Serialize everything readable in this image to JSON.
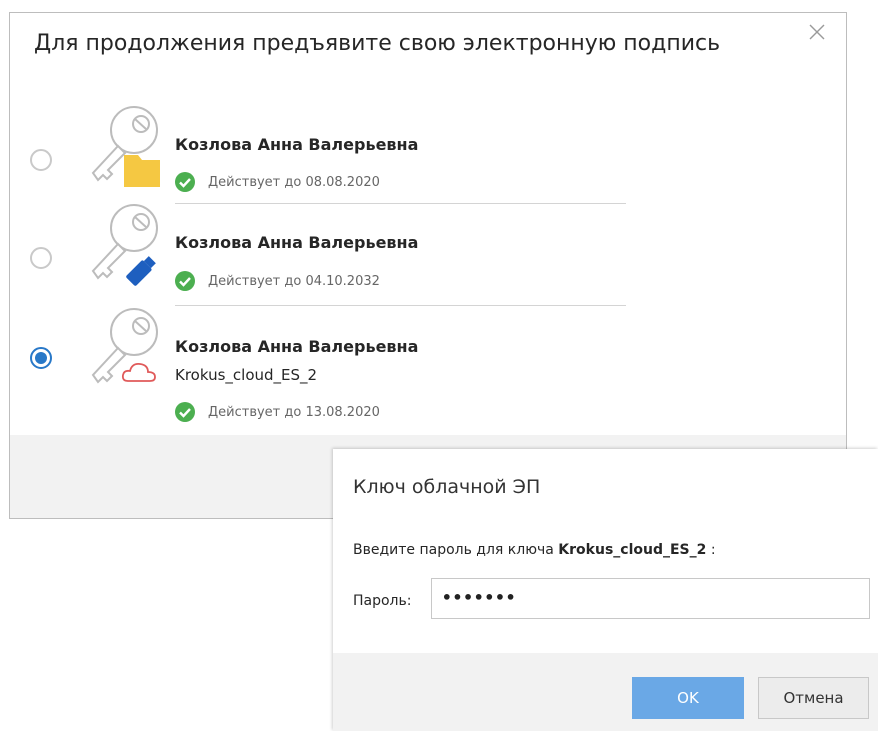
{
  "dialog": {
    "title": "Для продолжения предъявите свою электронную подпись",
    "close_icon": "close-icon",
    "certificates": [
      {
        "name": "Козлова Анна Валерьевна",
        "extra": "",
        "valid_text": "Действует до 08.08.2020",
        "storage_icon": "folder-icon",
        "selected": false
      },
      {
        "name": "Козлова Анна Валерьевна",
        "extra": "",
        "valid_text": "Действует до 04.10.2032",
        "storage_icon": "usb-token-icon",
        "selected": false
      },
      {
        "name": "Козлова Анна Валерьевна",
        "extra": "Krokus_cloud_ES_2",
        "valid_text": "Действует до 13.08.2020",
        "storage_icon": "cloud-icon",
        "selected": true
      }
    ]
  },
  "popup": {
    "title": "Ключ облачной ЭП",
    "prompt_prefix": "Введите пароль для ключа",
    "prompt_key": "Krokus_cloud_ES_2",
    "prompt_suffix": ":",
    "password_label": "Пароль:",
    "password_value": "•••••••",
    "ok_label": "OK",
    "cancel_label": "Отмена"
  },
  "colors": {
    "accent": "#2878c8",
    "ok_button": "#6aa8e6",
    "valid_check": "#4caf50",
    "folder": "#f5c842",
    "usb": "#1e5fbf",
    "cloud": "#e05a5a",
    "footer_bg": "#f2f2f2"
  }
}
